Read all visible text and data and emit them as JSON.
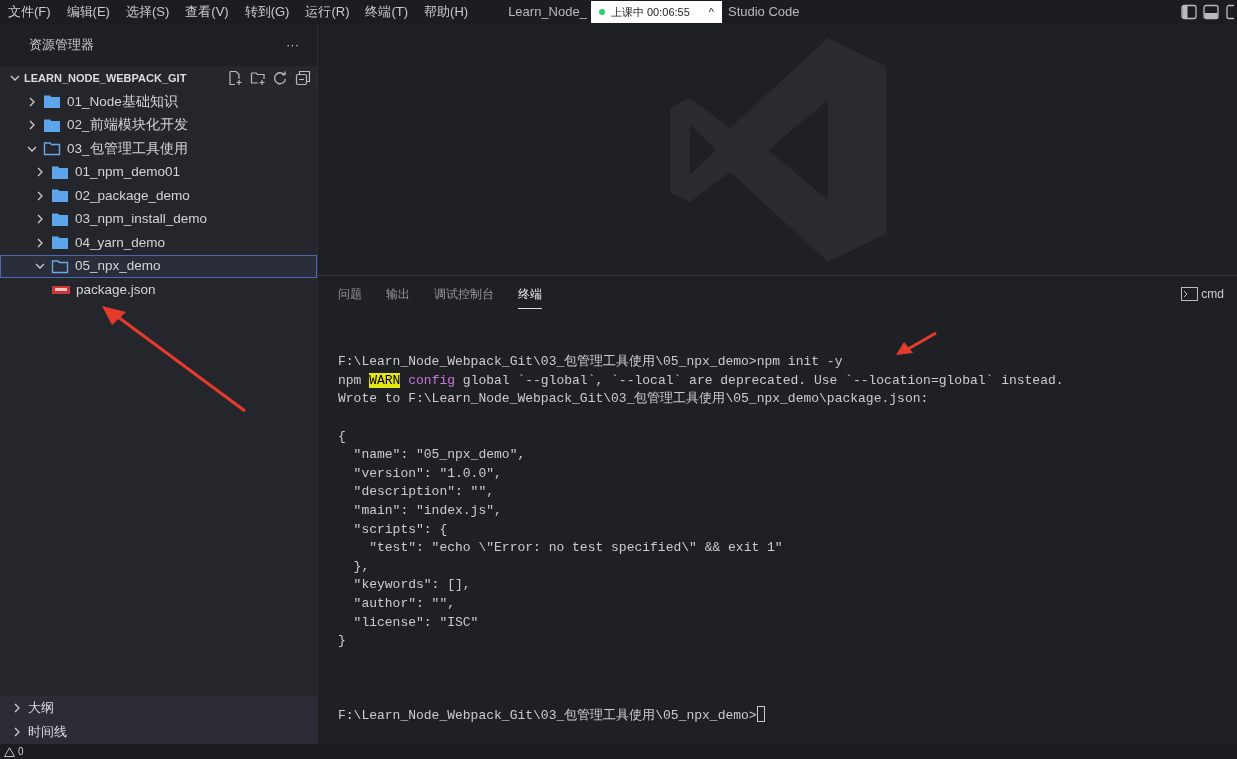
{
  "menu": [
    "文件(F)",
    "编辑(E)",
    "选择(S)",
    "查看(V)",
    "转到(G)",
    "运行(R)",
    "终端(T)",
    "帮助(H)"
  ],
  "title_left": "Learn_Node_",
  "recording": {
    "label": "上课中 00:06:55",
    "caret": "^"
  },
  "title_right": "Studio Code",
  "sidebar": {
    "title": "资源管理器",
    "more": "···",
    "root": {
      "label": "LEARN_NODE_WEBPACK_GIT",
      "expanded": true
    },
    "tree": [
      {
        "label": "01_Node基础知识",
        "kind": "folder",
        "expanded": false,
        "selected": false
      },
      {
        "label": "02_前端模块化开发",
        "kind": "folder",
        "expanded": false,
        "selected": false
      },
      {
        "label": "03_包管理工具使用",
        "kind": "folder",
        "expanded": true,
        "selected": false,
        "children": [
          {
            "label": "01_npm_demo01",
            "kind": "folder",
            "expanded": false,
            "selected": false
          },
          {
            "label": "02_package_demo",
            "kind": "folder",
            "expanded": false,
            "selected": false
          },
          {
            "label": "03_npm_install_demo",
            "kind": "folder",
            "expanded": false,
            "selected": false
          },
          {
            "label": "04_yarn_demo",
            "kind": "folder",
            "expanded": false,
            "selected": false
          },
          {
            "label": "05_npx_demo",
            "kind": "folder",
            "expanded": true,
            "selected": true,
            "children": [
              {
                "label": "package.json",
                "kind": "npm-file",
                "selected": false
              }
            ]
          }
        ]
      }
    ],
    "sections": [
      {
        "label": "大纲",
        "expanded": false
      },
      {
        "label": "时间线",
        "expanded": false
      }
    ]
  },
  "panel": {
    "tabs": [
      {
        "label": "问题",
        "selected": false
      },
      {
        "label": "输出",
        "selected": false
      },
      {
        "label": "调试控制台",
        "selected": false
      },
      {
        "label": "终端",
        "selected": true
      }
    ],
    "shell": "cmd",
    "lines": [
      {
        "gap_before": true,
        "segments": [
          {
            "text": "F:\\Learn_Node_Webpack_Git\\03_包管理工具使用\\05_npx_demo>npm init -y",
            "kind": "plain"
          }
        ]
      },
      {
        "segments": [
          {
            "text": "npm ",
            "kind": "plain"
          },
          {
            "text": "WARN",
            "kind": "warn"
          },
          {
            "text": "config",
            "kind": "keyword",
            "space_before": true
          },
          {
            "text": " global `--global`, `--local` are deprecated. Use `--location=global` instead.",
            "kind": "plain"
          }
        ]
      },
      {
        "segments": [
          {
            "text": "Wrote to F:\\Learn_Node_Webpack_Git\\03_包管理工具使用\\05_npx_demo\\package.json:",
            "kind": "plain"
          }
        ]
      },
      {
        "gap_before": true,
        "segments": [
          {
            "text": "{",
            "kind": "plain"
          }
        ]
      },
      {
        "segments": [
          {
            "text": "  \"name\": \"05_npx_demo\",",
            "kind": "plain"
          }
        ]
      },
      {
        "segments": [
          {
            "text": "  \"version\": \"1.0.0\",",
            "kind": "plain"
          }
        ]
      },
      {
        "segments": [
          {
            "text": "  \"description\": \"\",",
            "kind": "plain"
          }
        ]
      },
      {
        "segments": [
          {
            "text": "  \"main\": \"index.js\",",
            "kind": "plain"
          }
        ]
      },
      {
        "segments": [
          {
            "text": "  \"scripts\": {",
            "kind": "plain"
          }
        ]
      },
      {
        "segments": [
          {
            "text": "    \"test\": \"echo \\\"Error: no test specified\\\" && exit 1\"",
            "kind": "plain"
          }
        ]
      },
      {
        "segments": [
          {
            "text": "  },",
            "kind": "plain"
          }
        ]
      },
      {
        "segments": [
          {
            "text": "  \"keywords\": [],",
            "kind": "plain"
          }
        ]
      },
      {
        "segments": [
          {
            "text": "  \"author\": \"\",",
            "kind": "plain"
          }
        ]
      },
      {
        "segments": [
          {
            "text": "  \"license\": \"ISC\"",
            "kind": "plain"
          }
        ]
      },
      {
        "segments": [
          {
            "text": "}",
            "kind": "plain"
          }
        ]
      },
      {
        "gap_before": true,
        "cursor": true,
        "segments": [
          {
            "text": "F:\\Learn_Node_Webpack_Git\\03_包管理工具使用\\05_npx_demo>",
            "kind": "plain"
          }
        ]
      }
    ]
  },
  "status": {
    "warnings": "0"
  }
}
